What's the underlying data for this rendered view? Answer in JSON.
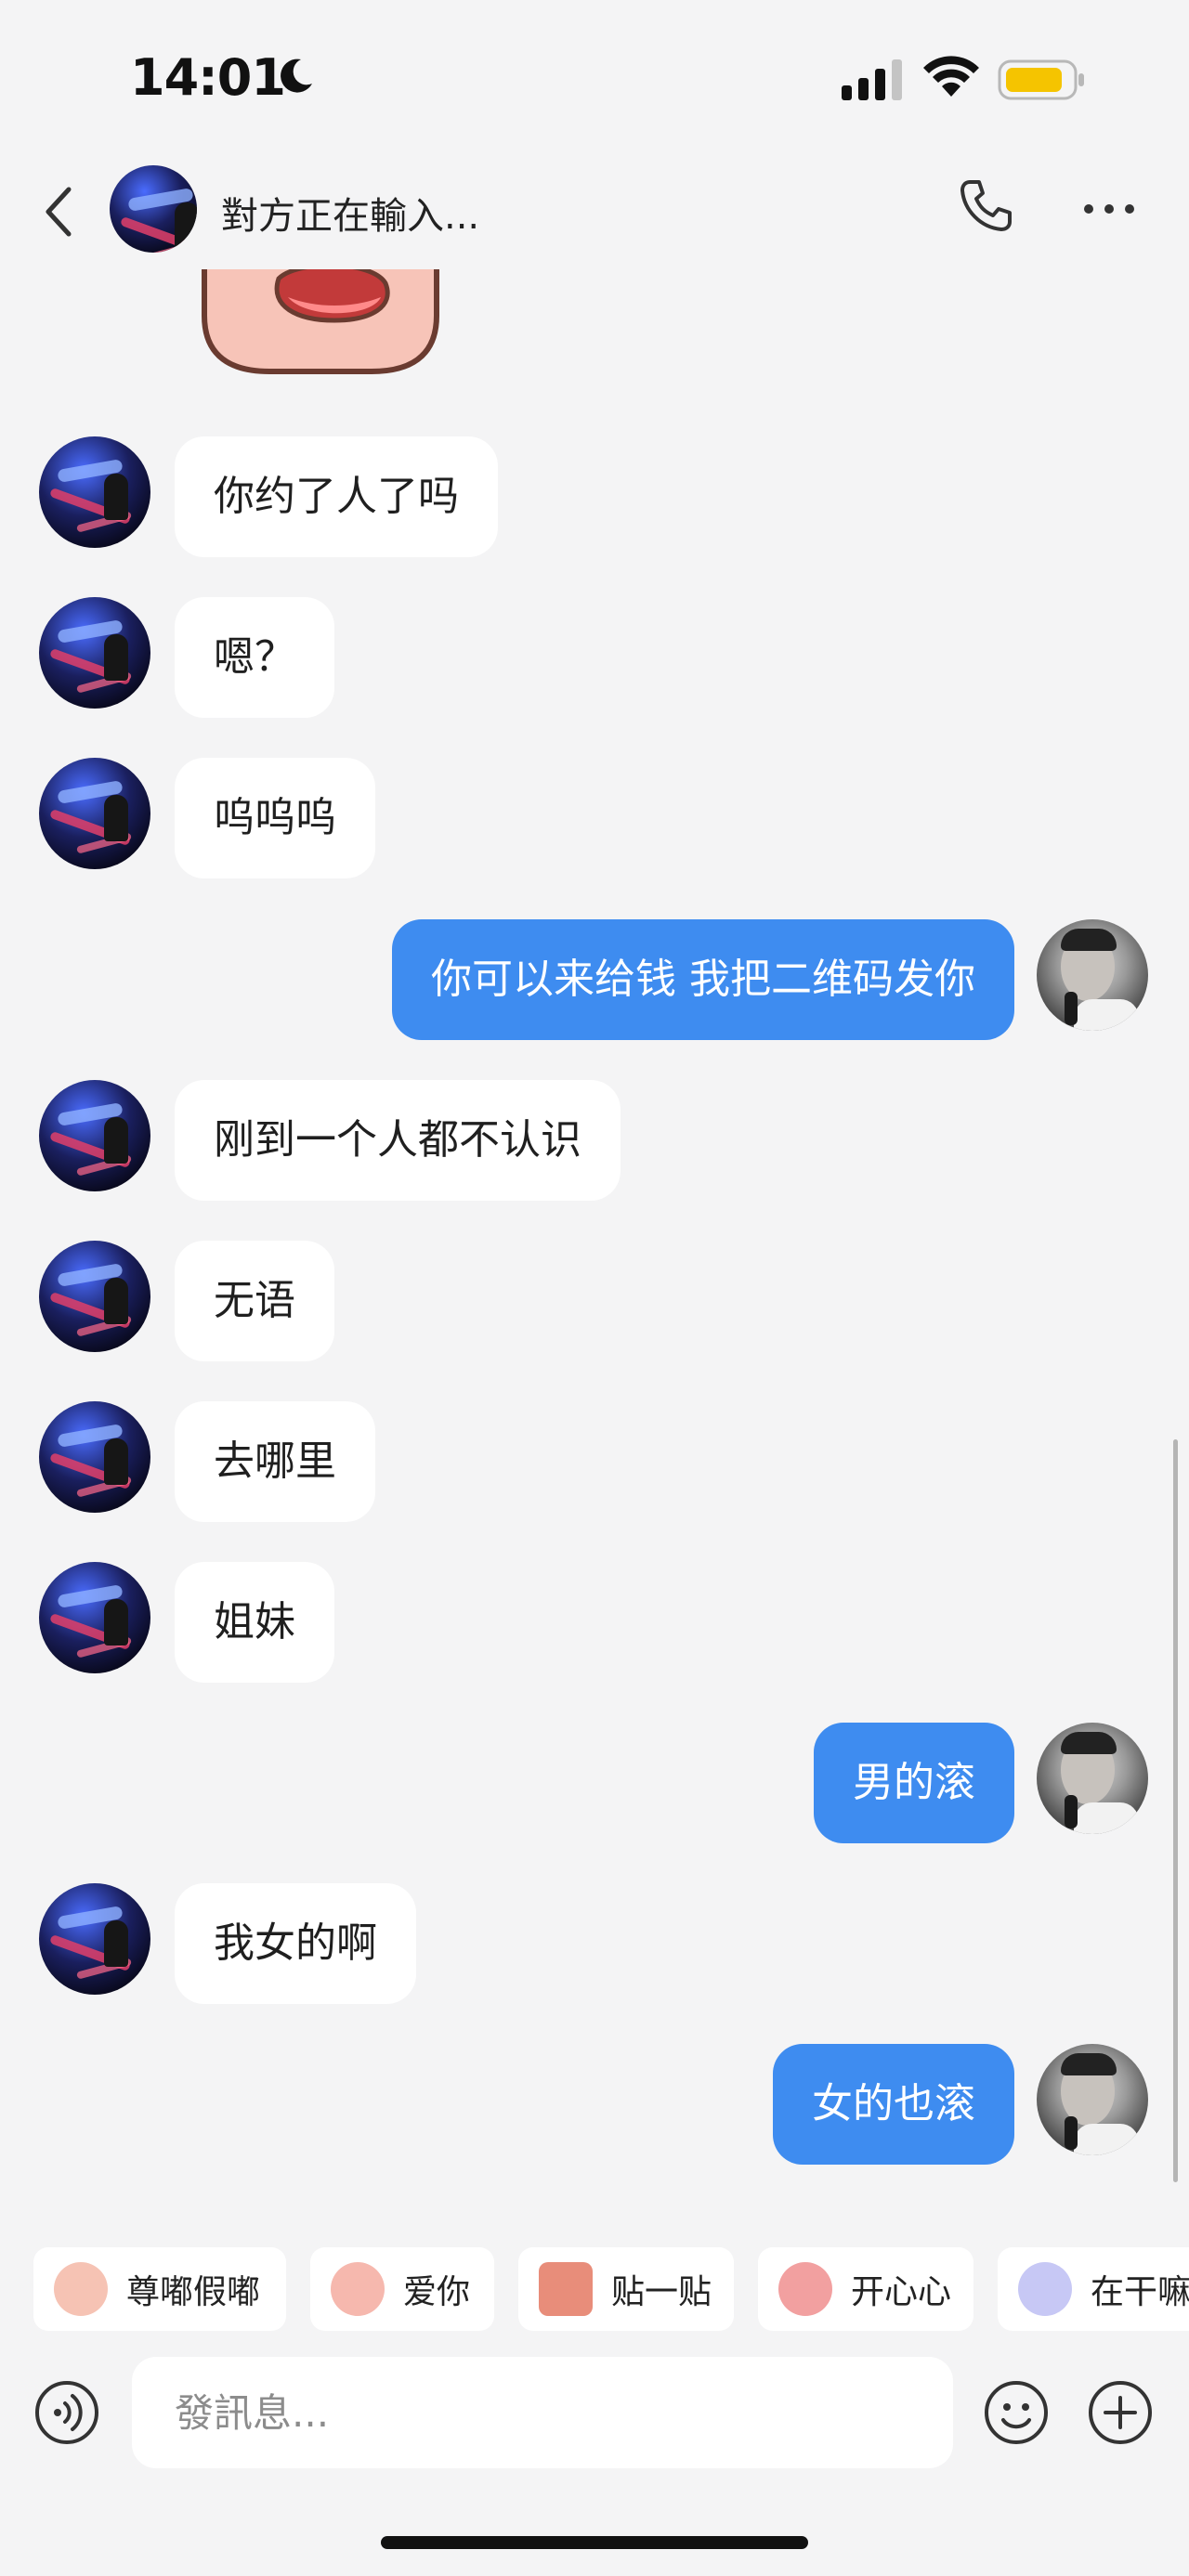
{
  "status": {
    "time": "14:01"
  },
  "header": {
    "title": "對方正在輸入..."
  },
  "messages": [
    {
      "side": "in",
      "text": "你约了人了吗"
    },
    {
      "side": "in",
      "text": "嗯？"
    },
    {
      "side": "in",
      "text": "呜呜呜"
    },
    {
      "side": "out",
      "text": "你可以来给钱 我把二维码发你"
    },
    {
      "side": "in",
      "text": "刚到一个人都不认识"
    },
    {
      "side": "in",
      "text": "无语"
    },
    {
      "side": "in",
      "text": "去哪里"
    },
    {
      "side": "in",
      "text": "姐妹"
    },
    {
      "side": "out",
      "text": "男的滚"
    },
    {
      "side": "in",
      "text": "我女的啊"
    },
    {
      "side": "out",
      "text": "女的也滚"
    }
  ],
  "quick_replies": [
    "尊嘟假嘟",
    "爱你",
    "贴一贴",
    "开心心",
    "在干嘛"
  ],
  "input": {
    "placeholder": "發訊息..."
  },
  "colors": {
    "outgoing_bubble": "#3e8cf0",
    "incoming_bubble": "#ffffff",
    "background": "#f4f4f5"
  },
  "icons": [
    "back-icon",
    "phone-icon",
    "more-icon",
    "voice-icon",
    "emoji-icon",
    "plus-icon",
    "moon-icon",
    "signal-icon",
    "wifi-icon",
    "battery-icon"
  ]
}
